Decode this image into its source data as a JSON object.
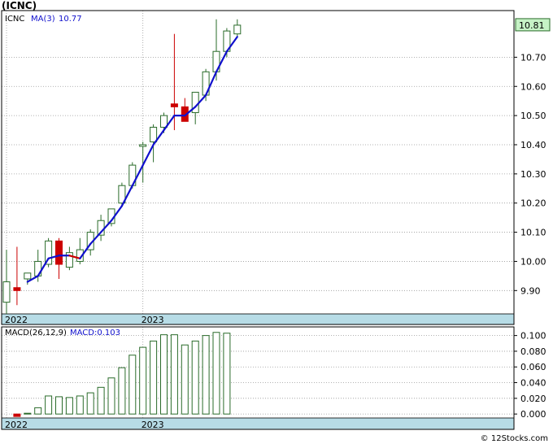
{
  "title": "(ICNC)",
  "footer": "© 12Stocks.com",
  "colors": {
    "up": "#2a6b2a",
    "down": "#cc0000",
    "ma_up": "#1010cc",
    "ma_down": "#cc0000",
    "axis_strip": "#b7dce6",
    "price_tag_bg": "#c6f2c6",
    "grid": "#999999"
  },
  "chart_data": [
    {
      "type": "candlestick",
      "legend": {
        "symbol": "ICNC",
        "ma_label": "MA(3)",
        "ma_value": "10.77"
      },
      "price_tag": "10.81",
      "ylim": [
        9.82,
        10.86
      ],
      "y_ticks": [
        9.9,
        10.0,
        10.1,
        10.2,
        10.3,
        10.4,
        10.5,
        10.6,
        10.7
      ],
      "y_tick_labels": [
        "9.90",
        "10.00",
        "10.10",
        "10.20",
        "10.30",
        "10.40",
        "10.50",
        "10.60",
        "10.70"
      ],
      "x_labels": [
        {
          "label": "2022",
          "index": 0
        },
        {
          "label": "2023",
          "index": 13
        }
      ],
      "grid": true,
      "candles": [
        {
          "o": 9.86,
          "h": 10.04,
          "l": 9.82,
          "c": 9.93
        },
        {
          "o": 9.91,
          "h": 10.05,
          "l": 9.85,
          "c": 9.9
        },
        {
          "o": 9.94,
          "h": 9.96,
          "l": 9.92,
          "c": 9.96
        },
        {
          "o": 9.95,
          "h": 10.04,
          "l": 9.93,
          "c": 10.0
        },
        {
          "o": 9.99,
          "h": 10.08,
          "l": 9.98,
          "c": 10.07
        },
        {
          "o": 10.07,
          "h": 10.08,
          "l": 9.94,
          "c": 9.99
        },
        {
          "o": 9.98,
          "h": 10.05,
          "l": 9.97,
          "c": 10.03
        },
        {
          "o": 10.0,
          "h": 10.08,
          "l": 9.99,
          "c": 10.04
        },
        {
          "o": 10.04,
          "h": 10.11,
          "l": 10.02,
          "c": 10.1
        },
        {
          "o": 10.09,
          "h": 10.16,
          "l": 10.07,
          "c": 10.14
        },
        {
          "o": 10.13,
          "h": 10.18,
          "l": 10.12,
          "c": 10.18
        },
        {
          "o": 10.2,
          "h": 10.27,
          "l": 10.19,
          "c": 10.26
        },
        {
          "o": 10.26,
          "h": 10.34,
          "l": 10.25,
          "c": 10.33
        },
        {
          "o": 10.4,
          "h": 10.41,
          "l": 10.27,
          "c": 10.4
        },
        {
          "o": 10.41,
          "h": 10.47,
          "l": 10.34,
          "c": 10.46
        },
        {
          "o": 10.46,
          "h": 10.51,
          "l": 10.44,
          "c": 10.5
        },
        {
          "o": 10.54,
          "h": 10.78,
          "l": 10.45,
          "c": 10.53
        },
        {
          "o": 10.53,
          "h": 10.56,
          "l": 10.48,
          "c": 10.48
        },
        {
          "o": 10.51,
          "h": 10.58,
          "l": 10.47,
          "c": 10.58
        },
        {
          "o": 10.57,
          "h": 10.66,
          "l": 10.55,
          "c": 10.65
        },
        {
          "o": 10.65,
          "h": 10.83,
          "l": 10.62,
          "c": 10.72
        },
        {
          "o": 10.72,
          "h": 10.8,
          "l": 10.7,
          "c": 10.79
        },
        {
          "o": 10.78,
          "h": 10.83,
          "l": 10.77,
          "c": 10.81
        }
      ],
      "ma3": [
        null,
        null,
        9.93,
        9.95,
        10.01,
        10.02,
        10.02,
        10.01,
        10.06,
        10.1,
        10.14,
        10.19,
        10.26,
        10.33,
        10.4,
        10.45,
        10.5,
        10.5,
        10.53,
        10.57,
        10.65,
        10.72,
        10.77
      ]
    },
    {
      "type": "bar",
      "legend": {
        "label": "MACD(26,12,9)",
        "value_label": "MACD:0.103"
      },
      "ylim": [
        -0.004,
        0.111
      ],
      "y_ticks": [
        0.0,
        0.02,
        0.04,
        0.06,
        0.08,
        0.1
      ],
      "y_tick_labels": [
        "0.000",
        "0.020",
        "0.040",
        "0.060",
        "0.080",
        "0.100"
      ],
      "x_labels": [
        {
          "label": "2022",
          "index": 0
        },
        {
          "label": "2023",
          "index": 13
        }
      ],
      "grid": true,
      "values": [
        null,
        -0.003,
        0.001,
        0.008,
        0.023,
        0.022,
        0.021,
        0.023,
        0.027,
        0.034,
        0.046,
        0.059,
        0.075,
        0.085,
        0.093,
        0.101,
        0.101,
        0.088,
        0.093,
        0.1,
        0.104,
        0.103
      ]
    }
  ]
}
